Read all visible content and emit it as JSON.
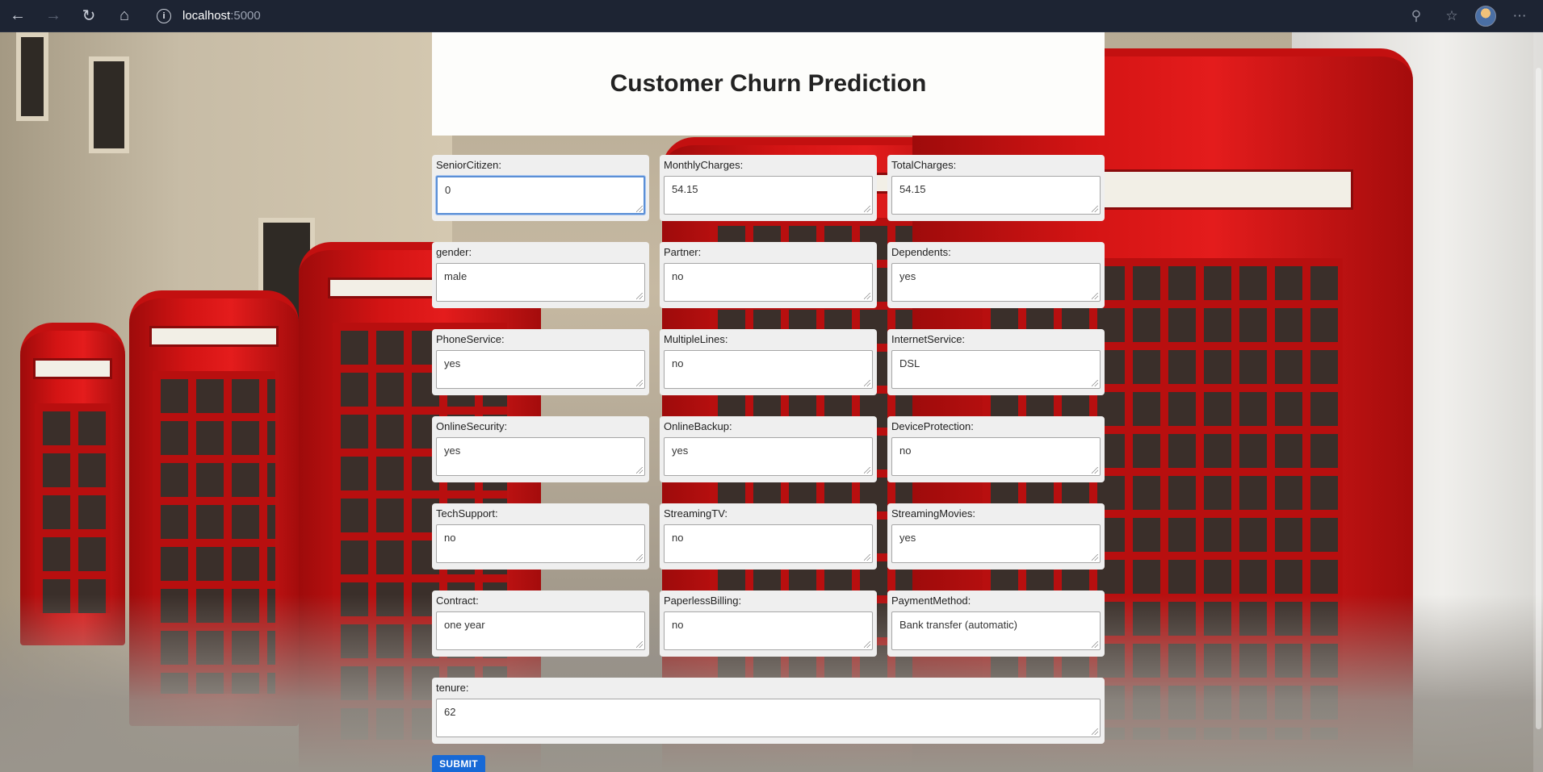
{
  "browser": {
    "url_host": "localhost",
    "url_port": ":5000",
    "info_icon": "i",
    "back_icon": "←",
    "forward_icon": "→",
    "reload_icon": "↻",
    "home_icon": "⌂",
    "zoom_icon": "⚲",
    "favorites_icon": "☆",
    "menu_icon": "⋯"
  },
  "page": {
    "title": "Customer Churn Prediction"
  },
  "form": {
    "fields": [
      {
        "label": "SeniorCitizen:",
        "value": "0"
      },
      {
        "label": "MonthlyCharges:",
        "value": "54.15"
      },
      {
        "label": "TotalCharges:",
        "value": "54.15"
      },
      {
        "label": "gender:",
        "value": "male"
      },
      {
        "label": "Partner:",
        "value": "no"
      },
      {
        "label": "Dependents:",
        "value": "yes"
      },
      {
        "label": "PhoneService:",
        "value": "yes"
      },
      {
        "label": "MultipleLines:",
        "value": "no"
      },
      {
        "label": "InternetService:",
        "value": "DSL"
      },
      {
        "label": "OnlineSecurity:",
        "value": "yes"
      },
      {
        "label": "OnlineBackup:",
        "value": "yes"
      },
      {
        "label": "DeviceProtection:",
        "value": "no"
      },
      {
        "label": "TechSupport:",
        "value": "no"
      },
      {
        "label": "StreamingTV:",
        "value": "no"
      },
      {
        "label": "StreamingMovies:",
        "value": "yes"
      },
      {
        "label": "Contract:",
        "value": "one year"
      },
      {
        "label": "PaperlessBilling:",
        "value": "no"
      },
      {
        "label": "PaymentMethod:",
        "value": "Bank transfer (automatic)"
      },
      {
        "label": "tenure:",
        "value": "62"
      }
    ],
    "submit_label": "SUBMIT"
  },
  "colors": {
    "submit": "#1769d6",
    "focus": "#5b8fd6",
    "field_bg": "#efefef"
  }
}
